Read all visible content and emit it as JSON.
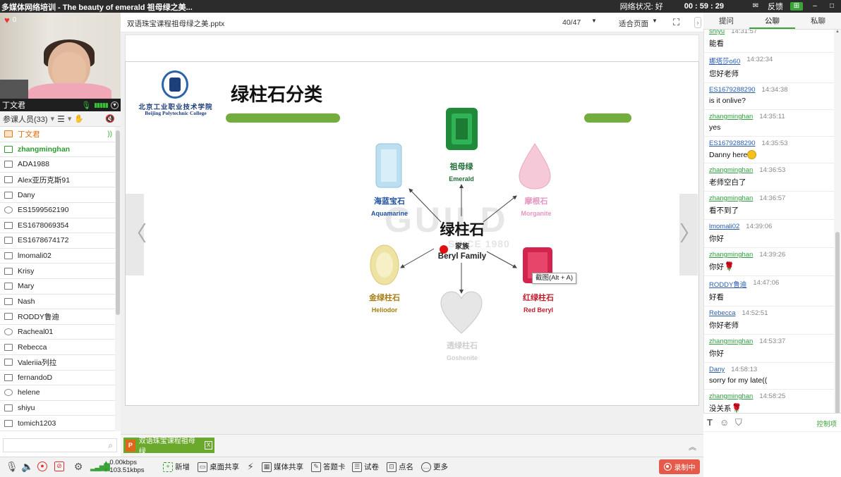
{
  "window": {
    "title": "多媒体网络培训 - The beauty of emerald 祖母绿之美...",
    "network_label": "网络状况:",
    "network_value": "好",
    "timer": "00 : 59 : 29",
    "feedback": "反馈"
  },
  "video": {
    "likes": "0",
    "camera_name": "丁文君"
  },
  "participants": {
    "header": "参课人员(33)",
    "items": [
      {
        "name": "丁文君",
        "type": "teacher"
      },
      {
        "name": "zhangminghan",
        "type": "green"
      },
      {
        "name": "ADA1988",
        "type": "pc"
      },
      {
        "name": "Alex亚历克斯91",
        "type": "pc"
      },
      {
        "name": "Dany",
        "type": "pc"
      },
      {
        "name": "ES1599562190",
        "type": "web"
      },
      {
        "name": "ES1678069354",
        "type": "pc"
      },
      {
        "name": "ES1678674172",
        "type": "pc"
      },
      {
        "name": "lmomali02",
        "type": "pc"
      },
      {
        "name": "Krisy",
        "type": "pc"
      },
      {
        "name": "Mary",
        "type": "pc"
      },
      {
        "name": "Nash",
        "type": "pc"
      },
      {
        "name": "RODDY鲁迪",
        "type": "pc"
      },
      {
        "name": "Racheal01",
        "type": "web"
      },
      {
        "name": "Rebecca",
        "type": "pc"
      },
      {
        "name": "Valeriia列拉",
        "type": "pc"
      },
      {
        "name": "fernandoD",
        "type": "pc"
      },
      {
        "name": "helene",
        "type": "web"
      },
      {
        "name": "shiyu",
        "type": "pc"
      },
      {
        "name": "tomich1203",
        "type": "pc"
      }
    ],
    "search_placeholder": ""
  },
  "document": {
    "filename": "双语珠宝课程祖母绿之美.pptx",
    "page": "40/47",
    "fit_mode": "适合页面"
  },
  "slide": {
    "logo_cn": "北京工业职业技术学院",
    "logo_en": "Beijing Polytechnic College",
    "title": "绿柱石分类",
    "watermark": "GUILD",
    "watermark_since": "SINCE 1980",
    "center_cn": "绿柱石",
    "center_sub": "家族",
    "center_en": "Beryl Family",
    "gems": [
      {
        "id": "emerald",
        "cn": "祖母绿",
        "en": "Emerald",
        "color": "#1f8a3a",
        "label_color": "#1f6e34"
      },
      {
        "id": "aquamarine",
        "cn": "海蓝宝石",
        "en": "Aquamarine",
        "color": "#bcdff0",
        "label_color": "#1e4fa0"
      },
      {
        "id": "morganite",
        "cn": "摩根石",
        "en": "Morganite",
        "color": "#f6c9d8",
        "label_color": "#e596c0"
      },
      {
        "id": "heliodor",
        "cn": "金绿柱石",
        "en": "Heliodor",
        "color": "#efe3a4",
        "label_color": "#a67d10"
      },
      {
        "id": "redberyl",
        "cn": "红绿柱石",
        "en": "Red Beryl",
        "color": "#d2244e",
        "label_color": "#c31d2c"
      },
      {
        "id": "goshenite",
        "cn": "透绿柱石",
        "en": "Goshenite",
        "color": "#e6e6e6",
        "label_color": "#cfcfcf"
      }
    ],
    "tooltip": "截图(Alt + A)"
  },
  "filetab": {
    "label": "双语珠宝课程祖母绿",
    "badge": "P"
  },
  "toolbar": {
    "kbps_down": "0.00kbps",
    "kbps_up": "103.51kbps",
    "new": "新增",
    "desktop_share": "桌面共享",
    "media_share": "媒体共享",
    "answer_card": "答题卡",
    "quiz": "试卷",
    "roll_call": "点名",
    "more": "更多",
    "record": "录制中"
  },
  "chat": {
    "tabs": [
      "提问",
      "公聊",
      "私聊"
    ],
    "active_tab": 1,
    "messages": [
      {
        "user": "shiyu",
        "time": "14:31:57",
        "text": "能看",
        "color": "green"
      },
      {
        "user": "娜塔莎o60",
        "time": "14:32:34",
        "text": "您好老师",
        "color": "blue"
      },
      {
        "user": "ES1679288290",
        "time": "14:34:38",
        "text": "is it onlive?",
        "color": "blue"
      },
      {
        "user": "zhangminghan",
        "time": "14:35:11",
        "text": "yes",
        "color": "green"
      },
      {
        "user": "ES1679288290",
        "time": "14:35:53",
        "text": "Danny here",
        "color": "blue",
        "emoji": "smile"
      },
      {
        "user": "zhangminghan",
        "time": "14:36:53",
        "text": "老师空白了",
        "color": "green"
      },
      {
        "user": "zhangminghan",
        "time": "14:36:57",
        "text": "看不到了",
        "color": "green"
      },
      {
        "user": "lmomali02",
        "time": "14:39:06",
        "text": "你好",
        "color": "blue"
      },
      {
        "user": "zhangminghan",
        "time": "14:39:26",
        "text": "你好",
        "color": "green",
        "emoji": "rose"
      },
      {
        "user": "RODDY鲁迪",
        "time": "14:47:06",
        "text": "好看",
        "color": "blue"
      },
      {
        "user": "Rebecca",
        "time": "14:52:51",
        "text": "你好老师",
        "color": "blue"
      },
      {
        "user": "zhangminghan",
        "time": "14:53:37",
        "text": "你好",
        "color": "green"
      },
      {
        "user": "Dany",
        "time": "14:58:13",
        "text": "sorry for my late((",
        "color": "blue"
      },
      {
        "user": "zhangminghan",
        "time": "14:58:25",
        "text": "没关系",
        "color": "green",
        "emoji": "rose"
      }
    ],
    "control_label": "控制项"
  },
  "colors": {
    "accent_green": "#3aa33a",
    "record_red": "#e55a4a",
    "slide_bar_green": "#73ad3e"
  }
}
